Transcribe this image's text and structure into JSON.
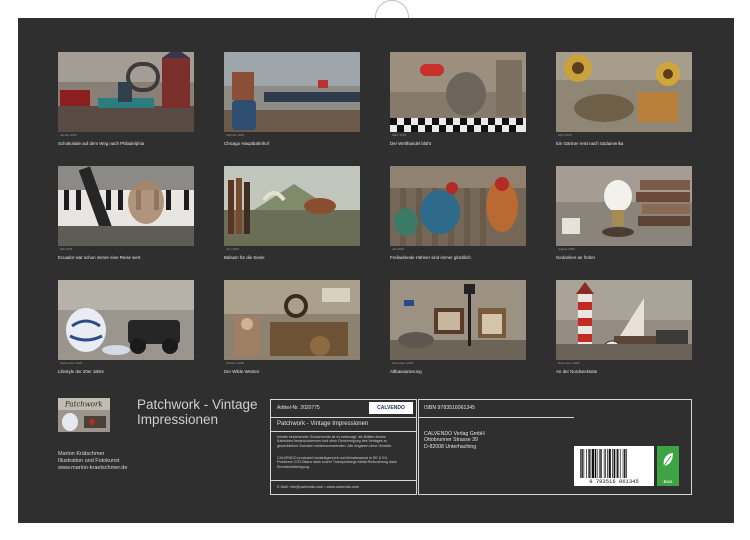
{
  "tiles": [
    {
      "month": "Januar 2025",
      "caption": "Schokolade auf dem Weg nach Philadelphia"
    },
    {
      "month": "Februar 2025",
      "caption": "Chicago Hauptbahnhof"
    },
    {
      "month": "März 2025",
      "caption": "Der Welthandel blüht"
    },
    {
      "month": "April 2025",
      "caption": "Ein Gärtner reist nach Südamerika"
    },
    {
      "month": "Mai 2025",
      "caption": "Ecuador war schon immer eine Reise wert"
    },
    {
      "month": "Juni 2025",
      "caption": "Balsam für die Seele"
    },
    {
      "month": "Juli 2025",
      "caption": "Freilaufende Hühner sind immer glücklich"
    },
    {
      "month": "August 2025",
      "caption": "Gedanken an früher"
    },
    {
      "month": "September 2025",
      "caption": "Lifestyle der 20er Jahre"
    },
    {
      "month": "Oktober 2025",
      "caption": "Der Wilde Westen"
    },
    {
      "month": "November 2025",
      "caption": "Altbausanierung"
    },
    {
      "month": "Dezember 2025",
      "caption": "An der Nordseeküste"
    }
  ],
  "cover": {
    "word": "Patchwork"
  },
  "title": "Patchwork - Vintage Impressionen",
  "author": {
    "name": "Marion Krätschmer",
    "profession": "Illustration und Fotokunst",
    "website": "www.marion-kraetschmer.de"
  },
  "info": {
    "article": "Artikel-Nr. 2020775",
    "brand": "CALVENDO",
    "product_title": "Patchwork - Vintage Impressionen",
    "legal": "Inhalte bestehender Schutzrechte ist es untersagt, die Blätter dieses Kalenders herauszutrennen und ohne Genehmigung des Verlages zu gewerblichen Zwecken weiterzuverwenden. Alle Angaben ohne Gewähr.",
    "climate": "CALVENDO produziert bedarfsgerecht und klimabewusst in DE & EU. Positivere CO2-Bilanz dank kurzer Transportwege Abfall-Reduzierung dank Einzelstückfertigung.",
    "contact": "E-Mail: info@calvendo.com • www.calvendo.com",
    "isbn": "ISBN 9783516061345",
    "publisher": [
      "CALVENDO Verlag GmbH",
      "Ottobrunner Strasse 39",
      "D-82008 Unterhaching"
    ],
    "barcode_text": "9 783516 061345",
    "eco": "ECO"
  }
}
